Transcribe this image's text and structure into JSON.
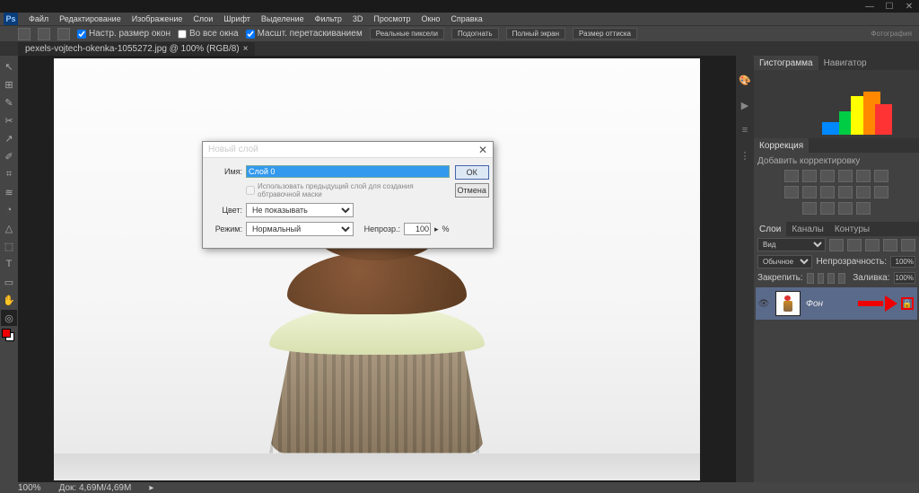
{
  "win_controls": {
    "min": "—",
    "max": "☐",
    "close": "✕"
  },
  "app_logo": "Ps",
  "menu": [
    "Файл",
    "Редактирование",
    "Изображение",
    "Слои",
    "Шрифт",
    "Выделение",
    "Фильтр",
    "3D",
    "Просмотр",
    "Окно",
    "Справка"
  ],
  "options": {
    "check1": "Настр. размер окон",
    "check2": "Во все окна",
    "check3": "Масшт. перетаскиванием",
    "btn1": "Реальные пиксели",
    "btn2": "Подогнать",
    "btn3": "Полный экран",
    "btn4": "Размер оттиска",
    "right": "Фотография"
  },
  "tab": {
    "name": "pexels-vojtech-okenka-1055272.jpg @ 100% (RGB/8)",
    "close": "×"
  },
  "tools": [
    "↖",
    "⊞",
    "✎",
    "✂",
    "↗",
    "✐",
    "⌗",
    "≋",
    "◔",
    "△",
    "⬚",
    "T",
    "▭",
    "✋",
    "◎"
  ],
  "rightbar": [
    "🎨",
    "▶",
    "≡",
    "⋮"
  ],
  "panels": {
    "histo_tab": "Гистограмма",
    "nav_tab": "Навигатор",
    "corr_tab": "Коррекция",
    "corr_add": "Добавить корректировку",
    "layers_tab": "Слои",
    "channels_tab": "Каналы",
    "paths_tab": "Контуры",
    "kind": "Вид",
    "mode_label": "Обычное",
    "opacity_label": "Непрозрачность:",
    "opacity_val": "100%",
    "lock_label": "Закрепить:",
    "fill_label": "Заливка:",
    "fill_val": "100%",
    "layer_name": "Фон",
    "lock_glyph": "🔒"
  },
  "dialog": {
    "title": "Новый слой",
    "close": "✕",
    "name_label": "Имя:",
    "name_value": "Слой 0",
    "clip_hint": "Использовать предыдущий слой для создания обтравочной маски",
    "color_label": "Цвет:",
    "color_value": "Не показывать",
    "mode_label": "Режим:",
    "mode_value": "Нормальный",
    "opacity_label": "Непрозр.:",
    "opacity_value": "100",
    "opacity_unit": "%",
    "arrow": "▸",
    "ok": "ОК",
    "cancel": "Отмена"
  },
  "status": {
    "zoom": "100%",
    "doc": "Док: 4,69M/4,69M",
    "arrow": "▸"
  }
}
